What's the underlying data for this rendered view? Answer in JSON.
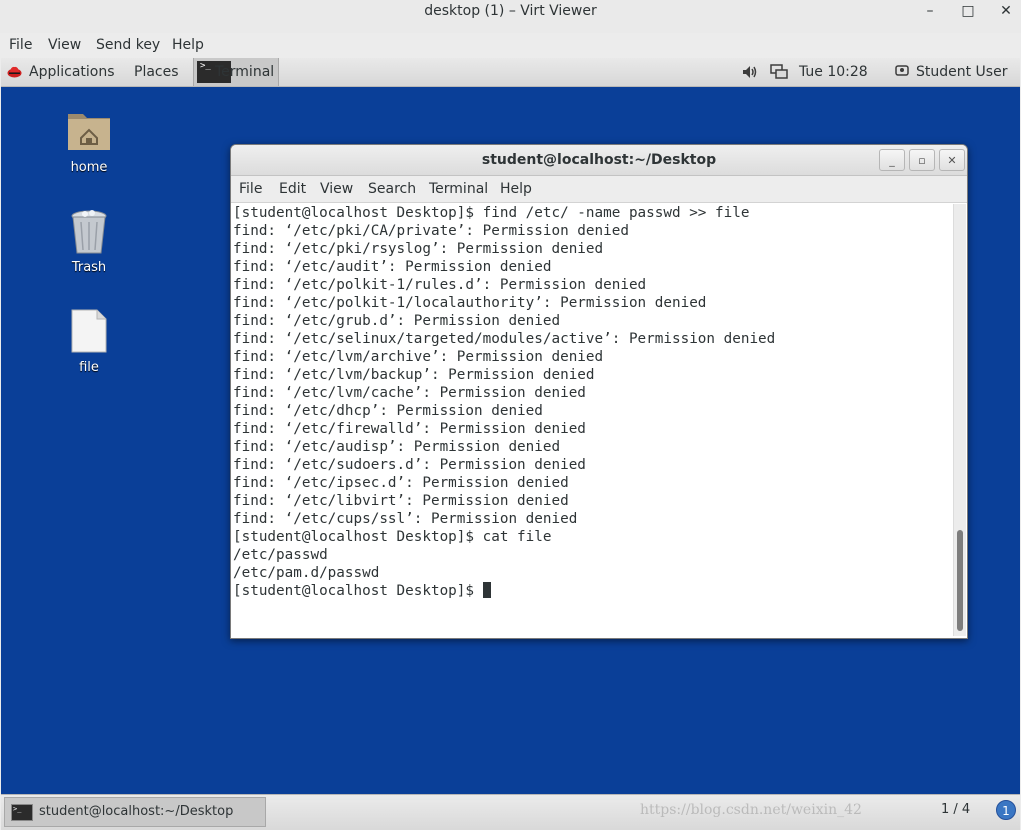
{
  "window": {
    "title": "desktop (1) – Virt Viewer",
    "minimize": "–",
    "maximize": "□",
    "close": "✕"
  },
  "menubar": [
    "File",
    "View",
    "Send key",
    "Help"
  ],
  "top_panel": {
    "applications": "Applications",
    "places": "Places",
    "terminal_task": "Terminal",
    "clock": "Tue 10:28",
    "user": "Student User"
  },
  "desktop_icons": {
    "home": "home",
    "trash": "Trash",
    "file": "file"
  },
  "terminal": {
    "title": "student@localhost:~/Desktop",
    "menu": [
      "File",
      "Edit",
      "View",
      "Search",
      "Terminal",
      "Help"
    ],
    "lines": [
      "[student@localhost Desktop]$ find /etc/ -name passwd >> file",
      "find: ‘/etc/pki/CA/private’: Permission denied",
      "find: ‘/etc/pki/rsyslog’: Permission denied",
      "find: ‘/etc/audit’: Permission denied",
      "find: ‘/etc/polkit-1/rules.d’: Permission denied",
      "find: ‘/etc/polkit-1/localauthority’: Permission denied",
      "find: ‘/etc/grub.d’: Permission denied",
      "find: ‘/etc/selinux/targeted/modules/active’: Permission denied",
      "find: ‘/etc/lvm/archive’: Permission denied",
      "find: ‘/etc/lvm/backup’: Permission denied",
      "find: ‘/etc/lvm/cache’: Permission denied",
      "find: ‘/etc/dhcp’: Permission denied",
      "find: ‘/etc/firewalld’: Permission denied",
      "find: ‘/etc/audisp’: Permission denied",
      "find: ‘/etc/sudoers.d’: Permission denied",
      "find: ‘/etc/ipsec.d’: Permission denied",
      "find: ‘/etc/libvirt’: Permission denied",
      "find: ‘/etc/cups/ssl’: Permission denied",
      "[student@localhost Desktop]$ cat file",
      "/etc/passwd",
      "/etc/pam.d/passwd"
    ],
    "prompt": "[student@localhost Desktop]$ "
  },
  "bottom_panel": {
    "task": "student@localhost:~/Desktop",
    "pager": "1 / 4",
    "watermark": "https://blog.csdn.net/weixin_42"
  }
}
